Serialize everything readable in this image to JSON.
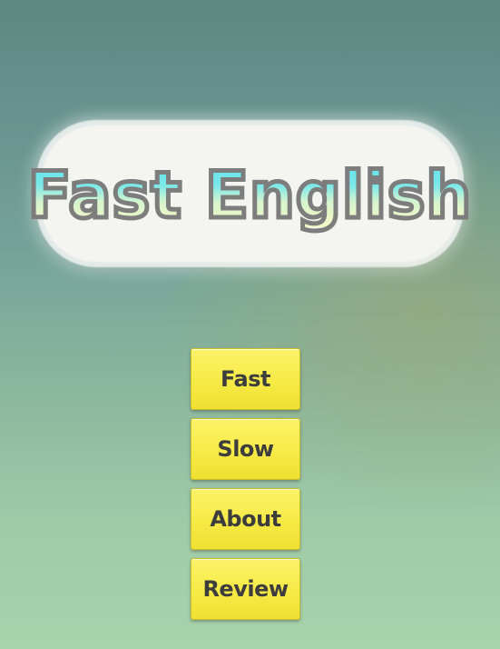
{
  "app": {
    "title": "Fast English"
  },
  "menu": {
    "items": [
      {
        "label": "Fast"
      },
      {
        "label": "Slow"
      },
      {
        "label": "About"
      },
      {
        "label": "Review"
      }
    ]
  },
  "colors": {
    "background_top": "#5e8782",
    "background_bottom": "#a9d3ab",
    "button_fill": "#f6ea45",
    "button_text": "#3d3d3d",
    "title_gradient_top": "#5fe3ec",
    "title_gradient_bottom": "#f6f9c4",
    "title_outline": "#7d7d7d",
    "title_plate": "#f4f4f0"
  }
}
